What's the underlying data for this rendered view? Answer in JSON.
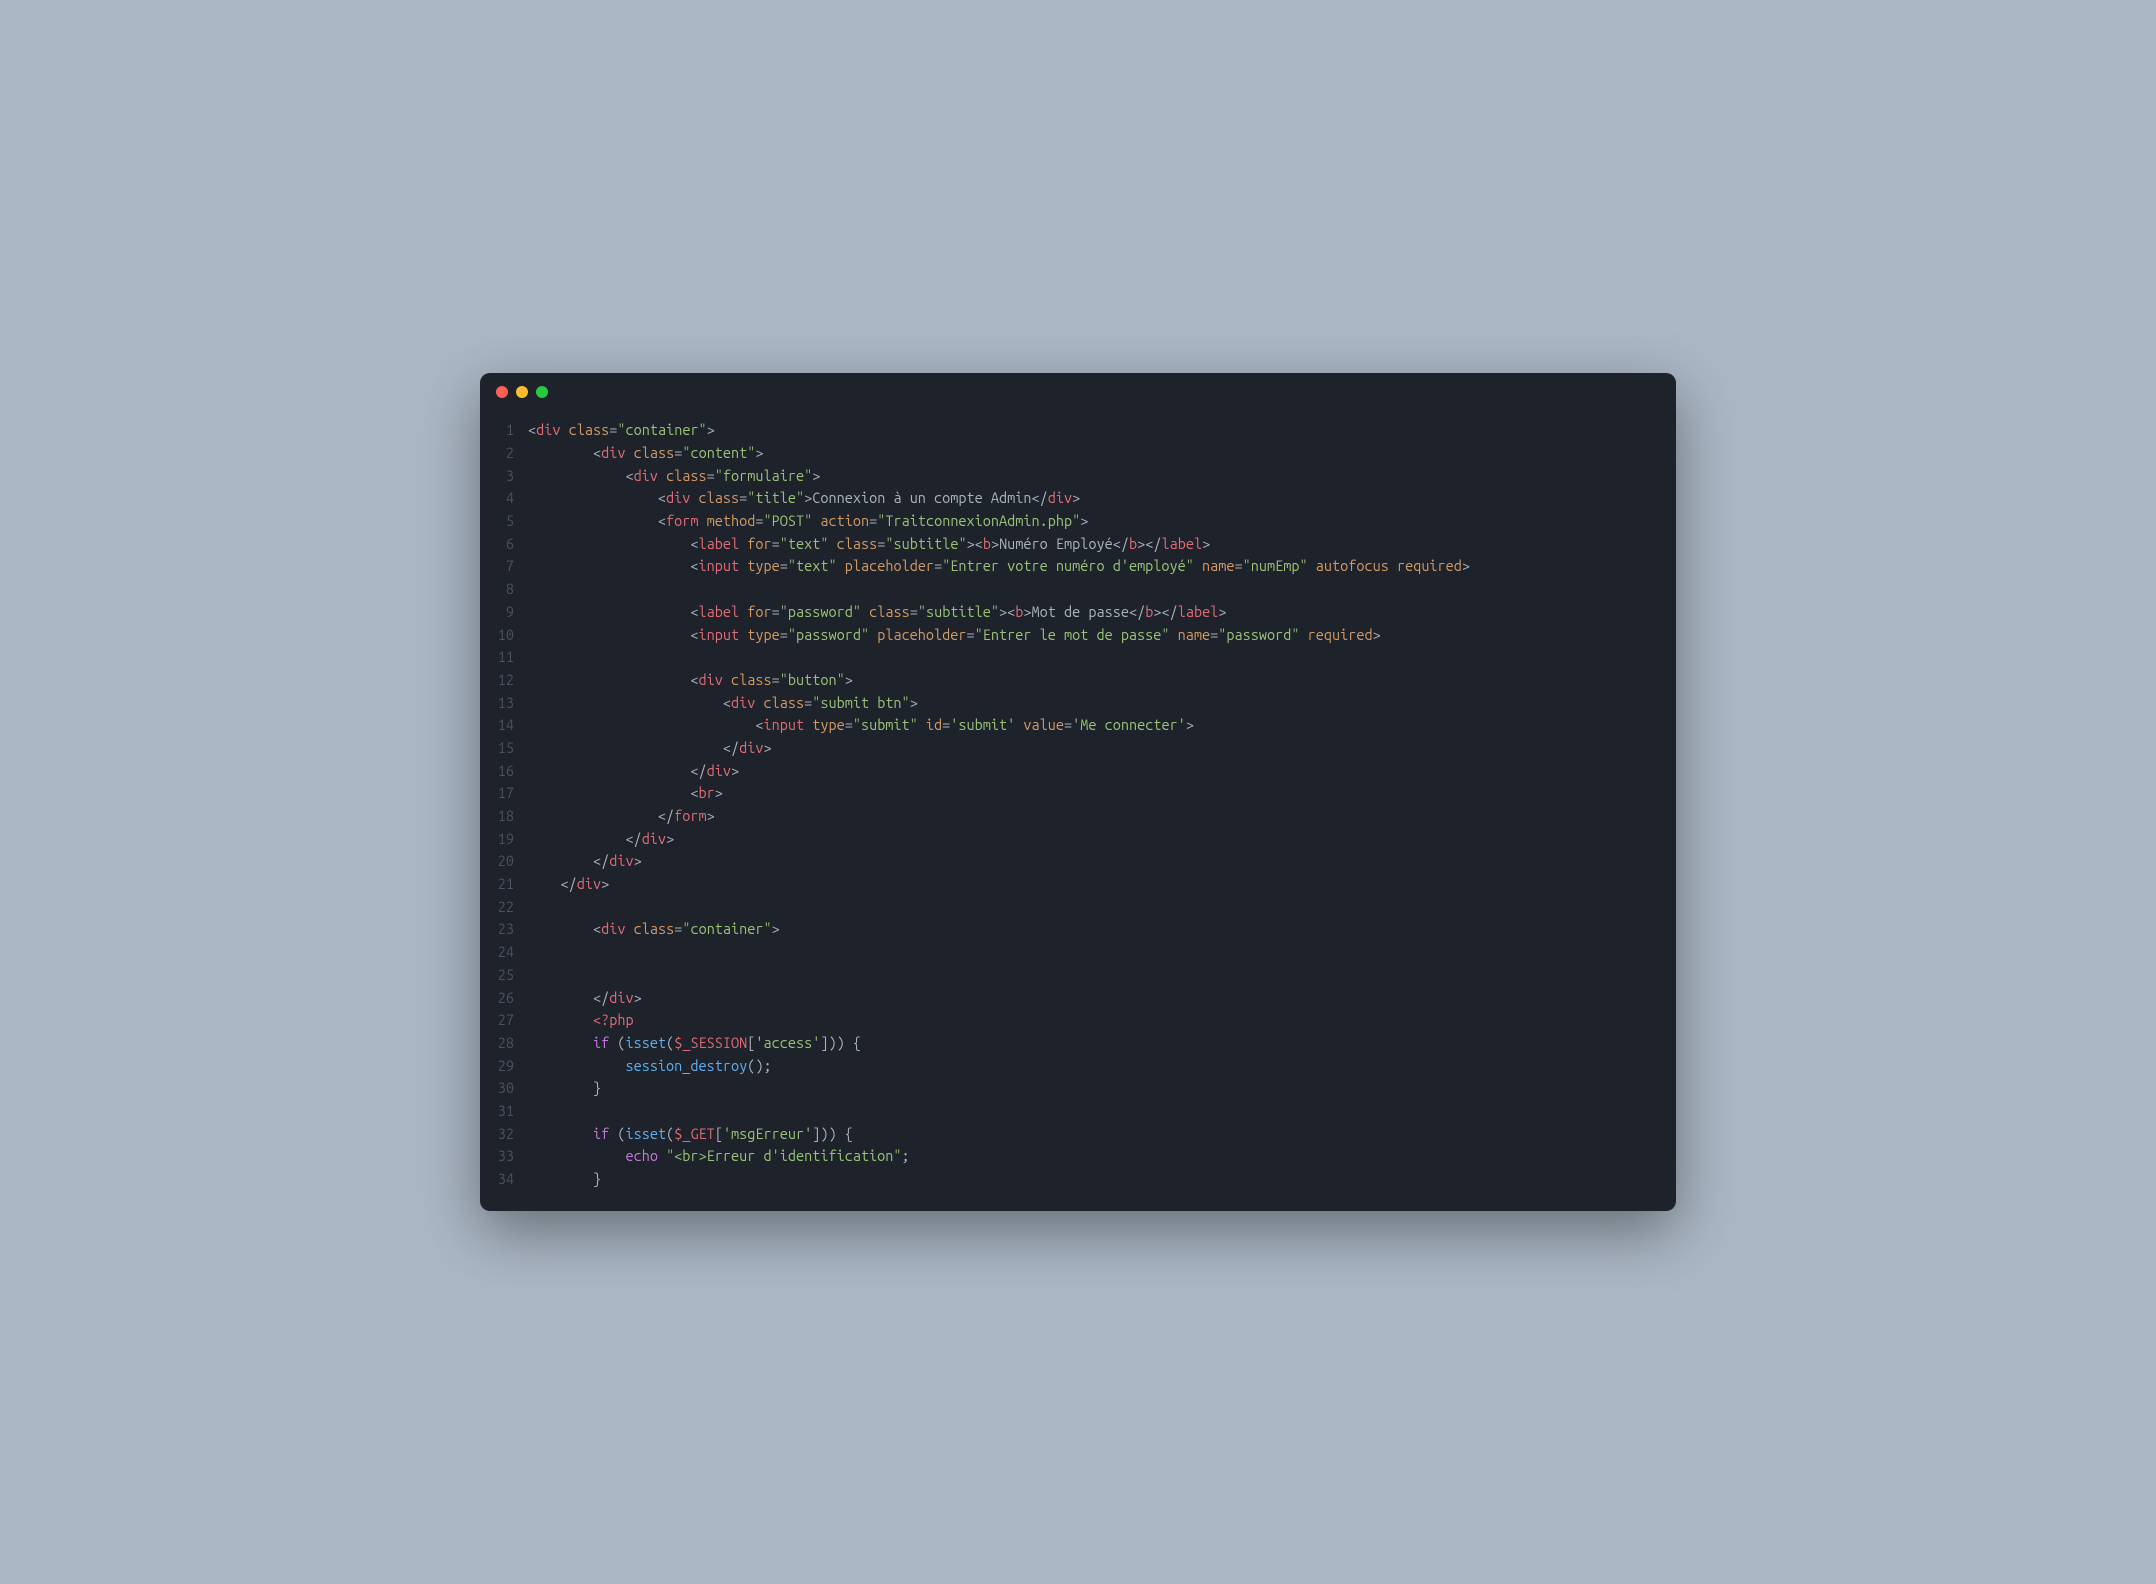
{
  "window": {
    "buttons": [
      "close",
      "minimize",
      "zoom"
    ]
  },
  "gutter": {
    "start": 1,
    "end": 34
  },
  "code": {
    "lines": [
      [
        [
          "p",
          "<"
        ],
        [
          "tg",
          "div"
        ],
        [
          "p",
          " "
        ],
        [
          "at",
          "class"
        ],
        [
          "eq",
          "="
        ],
        [
          "st",
          "\"container\""
        ],
        [
          "p",
          ">"
        ]
      ],
      [
        [
          "p",
          "        <"
        ],
        [
          "tg",
          "div"
        ],
        [
          "p",
          " "
        ],
        [
          "at",
          "class"
        ],
        [
          "eq",
          "="
        ],
        [
          "st",
          "\"content\""
        ],
        [
          "p",
          ">"
        ]
      ],
      [
        [
          "p",
          "            <"
        ],
        [
          "tg",
          "div"
        ],
        [
          "p",
          " "
        ],
        [
          "at",
          "class"
        ],
        [
          "eq",
          "="
        ],
        [
          "st",
          "\"formulaire\""
        ],
        [
          "p",
          ">"
        ]
      ],
      [
        [
          "p",
          "                <"
        ],
        [
          "tg",
          "div"
        ],
        [
          "p",
          " "
        ],
        [
          "at",
          "class"
        ],
        [
          "eq",
          "="
        ],
        [
          "st",
          "\"title\""
        ],
        [
          "p",
          ">"
        ],
        [
          "tx",
          "Connexion à un compte Admin"
        ],
        [
          "p",
          "</"
        ],
        [
          "tg",
          "div"
        ],
        [
          "p",
          ">"
        ]
      ],
      [
        [
          "p",
          "                <"
        ],
        [
          "tg",
          "form"
        ],
        [
          "p",
          " "
        ],
        [
          "at",
          "method"
        ],
        [
          "eq",
          "="
        ],
        [
          "st",
          "\"POST\""
        ],
        [
          "p",
          " "
        ],
        [
          "at",
          "action"
        ],
        [
          "eq",
          "="
        ],
        [
          "st",
          "\"TraitconnexionAdmin.php\""
        ],
        [
          "p",
          ">"
        ]
      ],
      [
        [
          "p",
          "                    <"
        ],
        [
          "tg",
          "label"
        ],
        [
          "p",
          " "
        ],
        [
          "at",
          "for"
        ],
        [
          "eq",
          "="
        ],
        [
          "st",
          "\"text\""
        ],
        [
          "p",
          " "
        ],
        [
          "at",
          "class"
        ],
        [
          "eq",
          "="
        ],
        [
          "st",
          "\"subtitle\""
        ],
        [
          "p",
          "><"
        ],
        [
          "tg",
          "b"
        ],
        [
          "p",
          ">"
        ],
        [
          "tx",
          "Numéro Employé"
        ],
        [
          "p",
          "</"
        ],
        [
          "tg",
          "b"
        ],
        [
          "p",
          "></"
        ],
        [
          "tg",
          "label"
        ],
        [
          "p",
          ">"
        ]
      ],
      [
        [
          "p",
          "                    <"
        ],
        [
          "tg",
          "input"
        ],
        [
          "p",
          " "
        ],
        [
          "at",
          "type"
        ],
        [
          "eq",
          "="
        ],
        [
          "st",
          "\"text\""
        ],
        [
          "p",
          " "
        ],
        [
          "at",
          "placeholder"
        ],
        [
          "eq",
          "="
        ],
        [
          "st",
          "\"Entrer votre numéro d'employé\""
        ],
        [
          "p",
          " "
        ],
        [
          "at",
          "name"
        ],
        [
          "eq",
          "="
        ],
        [
          "st",
          "\"numEmp\""
        ],
        [
          "p",
          " "
        ],
        [
          "at",
          "autofocus"
        ],
        [
          "p",
          " "
        ],
        [
          "at",
          "required"
        ],
        [
          "p",
          ">"
        ]
      ],
      [],
      [
        [
          "p",
          "                    <"
        ],
        [
          "tg",
          "label"
        ],
        [
          "p",
          " "
        ],
        [
          "at",
          "for"
        ],
        [
          "eq",
          "="
        ],
        [
          "st",
          "\"password\""
        ],
        [
          "p",
          " "
        ],
        [
          "at",
          "class"
        ],
        [
          "eq",
          "="
        ],
        [
          "st",
          "\"subtitle\""
        ],
        [
          "p",
          "><"
        ],
        [
          "tg",
          "b"
        ],
        [
          "p",
          ">"
        ],
        [
          "tx",
          "Mot de passe"
        ],
        [
          "p",
          "</"
        ],
        [
          "tg",
          "b"
        ],
        [
          "p",
          "></"
        ],
        [
          "tg",
          "label"
        ],
        [
          "p",
          ">"
        ]
      ],
      [
        [
          "p",
          "                    <"
        ],
        [
          "tg",
          "input"
        ],
        [
          "p",
          " "
        ],
        [
          "at",
          "type"
        ],
        [
          "eq",
          "="
        ],
        [
          "st",
          "\"password\""
        ],
        [
          "p",
          " "
        ],
        [
          "at",
          "placeholder"
        ],
        [
          "eq",
          "="
        ],
        [
          "st",
          "\"Entrer le mot de passe\""
        ],
        [
          "p",
          " "
        ],
        [
          "at",
          "name"
        ],
        [
          "eq",
          "="
        ],
        [
          "st",
          "\"password\""
        ],
        [
          "p",
          " "
        ],
        [
          "at",
          "required"
        ],
        [
          "p",
          ">"
        ]
      ],
      [],
      [
        [
          "p",
          "                    <"
        ],
        [
          "tg",
          "div"
        ],
        [
          "p",
          " "
        ],
        [
          "at",
          "class"
        ],
        [
          "eq",
          "="
        ],
        [
          "st",
          "\"button\""
        ],
        [
          "p",
          ">"
        ]
      ],
      [
        [
          "p",
          "                        <"
        ],
        [
          "tg",
          "div"
        ],
        [
          "p",
          " "
        ],
        [
          "at",
          "class"
        ],
        [
          "eq",
          "="
        ],
        [
          "st",
          "\"submit btn\""
        ],
        [
          "p",
          ">"
        ]
      ],
      [
        [
          "p",
          "                            <"
        ],
        [
          "tg",
          "input"
        ],
        [
          "p",
          " "
        ],
        [
          "at",
          "type"
        ],
        [
          "eq",
          "="
        ],
        [
          "st",
          "\"submit\""
        ],
        [
          "p",
          " "
        ],
        [
          "at",
          "id"
        ],
        [
          "eq",
          "="
        ],
        [
          "st",
          "'submit'"
        ],
        [
          "p",
          " "
        ],
        [
          "at",
          "value"
        ],
        [
          "eq",
          "="
        ],
        [
          "st",
          "'Me connecter'"
        ],
        [
          "p",
          ">"
        ]
      ],
      [
        [
          "p",
          "                        </"
        ],
        [
          "tg",
          "div"
        ],
        [
          "p",
          ">"
        ]
      ],
      [
        [
          "p",
          "                    </"
        ],
        [
          "tg",
          "div"
        ],
        [
          "p",
          ">"
        ]
      ],
      [
        [
          "p",
          "                    <"
        ],
        [
          "tg",
          "br"
        ],
        [
          "p",
          ">"
        ]
      ],
      [
        [
          "p",
          "                </"
        ],
        [
          "tg",
          "form"
        ],
        [
          "p",
          ">"
        ]
      ],
      [
        [
          "p",
          "            </"
        ],
        [
          "tg",
          "div"
        ],
        [
          "p",
          ">"
        ]
      ],
      [
        [
          "p",
          "        </"
        ],
        [
          "tg",
          "div"
        ],
        [
          "p",
          ">"
        ]
      ],
      [
        [
          "p",
          "    </"
        ],
        [
          "tg",
          "div"
        ],
        [
          "p",
          ">"
        ]
      ],
      [],
      [
        [
          "p",
          "        <"
        ],
        [
          "tg",
          "div"
        ],
        [
          "p",
          " "
        ],
        [
          "at",
          "class"
        ],
        [
          "eq",
          "="
        ],
        [
          "st",
          "\"container\""
        ],
        [
          "p",
          ">"
        ]
      ],
      [],
      [],
      [
        [
          "p",
          "        </"
        ],
        [
          "tg",
          "div"
        ],
        [
          "p",
          ">"
        ]
      ],
      [
        [
          "p",
          "        "
        ],
        [
          "tg",
          "<?php"
        ]
      ],
      [
        [
          "p",
          "        "
        ],
        [
          "kw",
          "if"
        ],
        [
          "p",
          " ("
        ],
        [
          "fn",
          "isset"
        ],
        [
          "p",
          "("
        ],
        [
          "vr",
          "$_SESSION"
        ],
        [
          "p",
          "["
        ],
        [
          "st",
          "'access'"
        ],
        [
          "p",
          "])) {"
        ]
      ],
      [
        [
          "p",
          "            "
        ],
        [
          "fn",
          "session_destroy"
        ],
        [
          "p",
          "();"
        ]
      ],
      [
        [
          "p",
          "        }"
        ]
      ],
      [],
      [
        [
          "p",
          "        "
        ],
        [
          "kw",
          "if"
        ],
        [
          "p",
          " ("
        ],
        [
          "fn",
          "isset"
        ],
        [
          "p",
          "("
        ],
        [
          "vr",
          "$_GET"
        ],
        [
          "p",
          "["
        ],
        [
          "st",
          "'msgErreur'"
        ],
        [
          "p",
          "])) {"
        ]
      ],
      [
        [
          "p",
          "            "
        ],
        [
          "kw",
          "echo"
        ],
        [
          "p",
          " "
        ],
        [
          "st",
          "\"<br>Erreur d'identification\""
        ],
        [
          "p",
          ";"
        ]
      ],
      [
        [
          "p",
          "        }"
        ]
      ]
    ]
  }
}
